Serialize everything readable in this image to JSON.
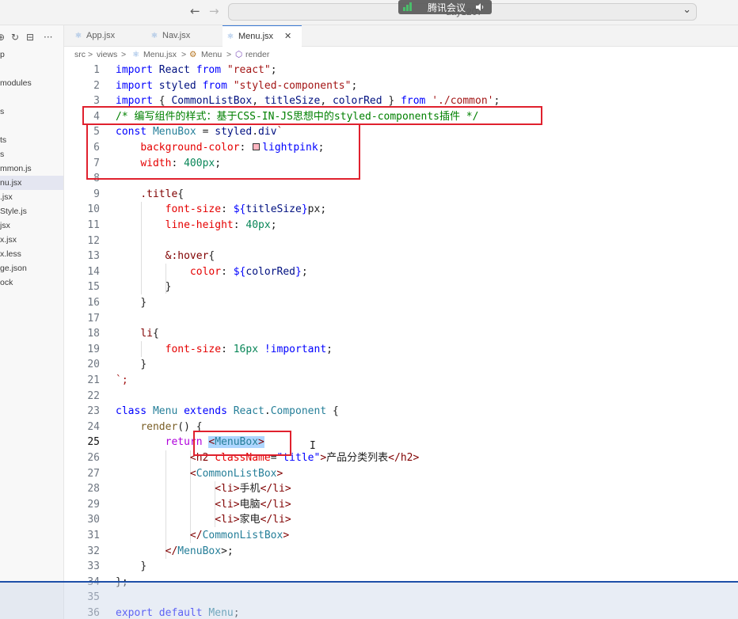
{
  "titlebar": {
    "back_glyph": "←",
    "forward_glyph": "→",
    "command_center_text": "day1207",
    "chevron_glyph": "⌄",
    "meeting_overlay_label": "腾讯会议"
  },
  "sidebar": {
    "action_glyphs": [
      "⊕",
      "↻",
      "⊟",
      "···"
    ],
    "items": [
      {
        "label": "p",
        "active": false
      },
      {
        "label": "modules",
        "active": false
      },
      {
        "label": "s",
        "active": false
      },
      {
        "label": "ts",
        "active": false
      },
      {
        "label": "s",
        "active": false
      },
      {
        "label": "mmon.js",
        "active": false
      },
      {
        "label": "nu.jsx",
        "active": true
      },
      {
        "label": ".jsx",
        "active": false
      },
      {
        "label": "Style.js",
        "active": false
      },
      {
        "label": "jsx",
        "active": false
      },
      {
        "label": "x.jsx",
        "active": false
      },
      {
        "label": "x.less",
        "active": false
      },
      {
        "label": "ge.json",
        "active": false
      },
      {
        "label": "ock",
        "active": false
      }
    ]
  },
  "tabs": [
    {
      "label": "App.jsx",
      "active": false,
      "icon": "⚛"
    },
    {
      "label": "Nav.jsx",
      "active": false,
      "icon": "⚛"
    },
    {
      "label": "Menu.jsx",
      "active": true,
      "icon": "⚛"
    }
  ],
  "tab_close_glyph": "✕",
  "breadcrumb": {
    "parts": [
      "src",
      "views",
      "Menu.jsx",
      "Menu",
      "render"
    ],
    "separator": ">"
  },
  "editor": {
    "line_numbers": [
      "1",
      "2",
      "3",
      "4",
      "5",
      "6",
      "7",
      "8",
      "9",
      "10",
      "11",
      "12",
      "13",
      "14",
      "15",
      "16",
      "17",
      "18",
      "19",
      "20",
      "21",
      "22",
      "23",
      "24",
      "25",
      "26",
      "27",
      "28",
      "29",
      "30",
      "31",
      "32",
      "33",
      "34",
      "35",
      "36"
    ],
    "current_line": "25",
    "code": {
      "l1": {
        "a": "import",
        "b": "React",
        "c": "from",
        "d": "\"react\"",
        "e": ";"
      },
      "l2": {
        "a": "import",
        "b": "styled",
        "c": "from",
        "d": "\"styled-components\"",
        "e": ";"
      },
      "l3": {
        "a": "import",
        "b": "{",
        "c": "CommonListBox",
        "d": ",",
        "e": "titleSize",
        "f": ",",
        "g": "colorRed",
        "h": "}",
        "i": "from",
        "j": "'./common'",
        "k": ";"
      },
      "l4": {
        "a": "/* 编写组件的样式：基于CSS-IN-JS思想中的styled-components插件 */"
      },
      "l5": {
        "a": "const",
        "b": "MenuBox",
        "c": "=",
        "d": "styled",
        "e": ".",
        "f": "div",
        "g": "`"
      },
      "l6": {
        "a": "background-color",
        "b": ":",
        "c": "lightpink",
        "d": ";"
      },
      "l7": {
        "a": "width",
        "b": ":",
        "c": "400px",
        "d": ";"
      },
      "l9": {
        "a": ".title",
        "b": "{"
      },
      "l10": {
        "a": "font-size",
        "b": ":",
        "c": "${",
        "d": "titleSize",
        "e": "}",
        "f": "px;"
      },
      "l11": {
        "a": "line-height",
        "b": ":",
        "c": "40px",
        "d": ";"
      },
      "l13": {
        "a": "&:hover",
        "b": "{"
      },
      "l14": {
        "a": "color",
        "b": ":",
        "c": "${",
        "d": "colorRed",
        "e": "}",
        "f": ";"
      },
      "l15": {
        "a": "}"
      },
      "l16": {
        "a": "}"
      },
      "l18": {
        "a": "li",
        "b": "{"
      },
      "l19": {
        "a": "font-size",
        "b": ":",
        "c": "16px",
        "d": "!important",
        "e": ";"
      },
      "l20": {
        "a": "}"
      },
      "l21": {
        "a": "`;"
      },
      "l23": {
        "a": "class",
        "b": "Menu",
        "c": "extends",
        "d": "React",
        "e": ".",
        "f": "Component",
        "g": "{"
      },
      "l24": {
        "a": "render",
        "b": "()",
        "c": "{"
      },
      "l25": {
        "a": "return",
        "b": "<",
        "c": "MenuBox",
        "d": ">"
      },
      "l26": {
        "a": "<",
        "b": "h2",
        "c": "className",
        "d": "=",
        "e": "\"title\"",
        "f": ">",
        "g": "产品分类列表",
        "h": "</",
        "i": "h2",
        "j": ">"
      },
      "l27": {
        "a": "<",
        "b": "CommonListBox",
        "c": ">"
      },
      "l28": {
        "a": "<",
        "b": "li",
        "c": ">",
        "d": "手机",
        "e": "</",
        "f": "li",
        "g": ">"
      },
      "l29": {
        "a": "<",
        "b": "li",
        "c": ">",
        "d": "电脑",
        "e": "</",
        "f": "li",
        "g": ">"
      },
      "l30": {
        "a": "<",
        "b": "li",
        "c": ">",
        "d": "家电",
        "e": "</",
        "f": "li",
        "g": ">"
      },
      "l31": {
        "a": "</",
        "b": "CommonListBox",
        "c": ">"
      },
      "l32": {
        "a": "</",
        "b": "MenuBox",
        "c": ">;"
      },
      "l33": {
        "a": "}"
      },
      "l34": {
        "a": "};"
      },
      "l36": {
        "a": "export",
        "b": "default",
        "c": "Menu",
        "d": ";"
      }
    },
    "text_cursor_glyph": "I",
    "color_swatch": "#ffb6c1"
  },
  "annotation_color": "#e0212e",
  "accent_color": "#1d4fa8"
}
